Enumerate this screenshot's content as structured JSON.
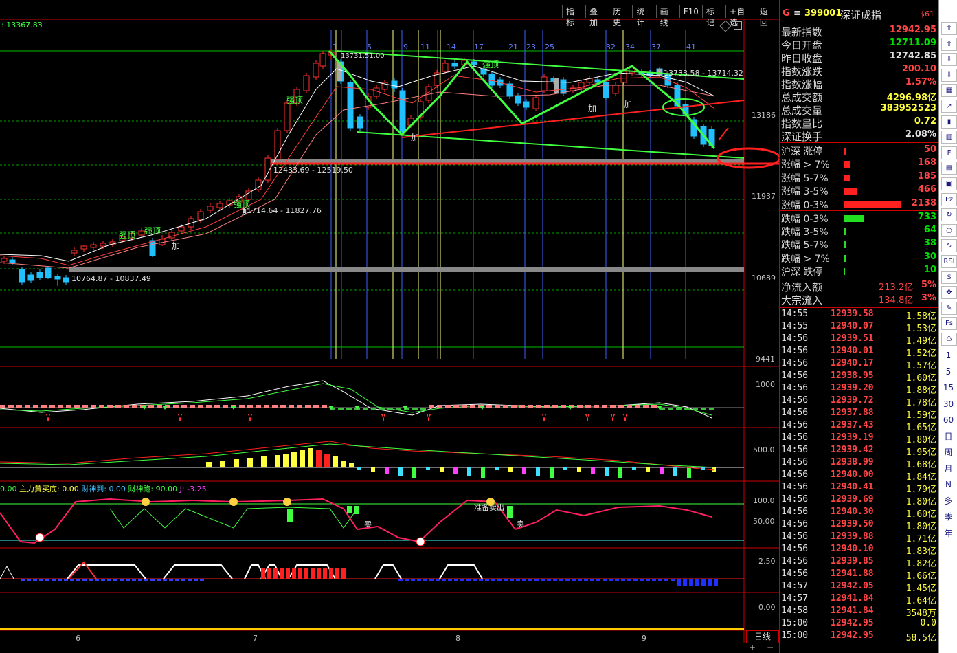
{
  "toolbar": [
    "指标",
    "叠加",
    "历史",
    "统计",
    "画线",
    "F10",
    "标记",
    "+自选",
    "返回"
  ],
  "chart": {
    "top_left_value": ": 13367.83",
    "y_axis_labels": [
      "13186",
      "11937",
      "10689",
      "9441"
    ],
    "date_labels": [
      "6",
      "7",
      "8",
      "9"
    ],
    "period_label": "日线",
    "wave_numbers": [
      "1",
      "5",
      "9",
      "11",
      "14",
      "17",
      "21",
      "23",
      "25",
      "32",
      "34",
      "37",
      "41"
    ],
    "annotations": {
      "range1": "12433.69 - 12519.50",
      "range2": "11714.64 - 11827.76",
      "range3": "10764.87 - 10837.49",
      "range4": "13733.58 - 13714.32",
      "top_range": "13731.51.00",
      "strong_top": "强顶",
      "add": "加",
      "sell": "卖",
      "ready_sell": "准备卖出"
    },
    "sub1_axis": "1000",
    "sub2_axis": "500.0",
    "sub3_header": {
      "zero": "0.00",
      "zhuli_label": "主力黄买底:",
      "zhuli_value": "0.00",
      "caishen_dao_label": "财神到:",
      "caishen_dao_value": "0.00",
      "caishen_pao_label": "财神跑:",
      "caishen_pao_value": "90.00",
      "j_label": "J:",
      "j_value": "-3.25"
    },
    "sub3_axis": [
      "100.0",
      "50.00"
    ],
    "sub4_axis": "2.50",
    "sub5_axis": "0.00"
  },
  "panel": {
    "title_code": "399001",
    "title_name": "深证成指",
    "title_flag": "$61",
    "stats": [
      {
        "label": "最新指数",
        "value": "12942.95",
        "color": "red"
      },
      {
        "label": "今日开盘",
        "value": "12711.09",
        "color": "green"
      },
      {
        "label": "昨日收盘",
        "value": "12742.85",
        "color": "white"
      },
      {
        "label": "指数涨跌",
        "value": "200.10",
        "color": "red"
      },
      {
        "label": "指数涨幅",
        "value": "1.57%",
        "color": "red"
      },
      {
        "label": "总成交额",
        "value": "4296.98亿",
        "color": "yellow"
      },
      {
        "label": "总成交量",
        "value": "383952523",
        "color": "yellow"
      },
      {
        "label": "指数量比",
        "value": "0.72",
        "color": "yellow"
      },
      {
        "label": "深证换手",
        "value": "2.08%",
        "color": "white"
      }
    ],
    "ups": [
      {
        "label": "沪深 涨停",
        "value": "50",
        "bar": 2
      },
      {
        "label": "涨幅 > 7%",
        "value": "168",
        "bar": 8
      },
      {
        "label": "涨幅 5-7%",
        "value": "185",
        "bar": 8
      },
      {
        "label": "涨幅 3-5%",
        "value": "466",
        "bar": 18
      },
      {
        "label": "涨幅 0-3%",
        "value": "2138",
        "bar": 82
      }
    ],
    "downs": [
      {
        "label": "跌幅 0-3%",
        "value": "733",
        "bar": 28
      },
      {
        "label": "跌幅 3-5%",
        "value": "64",
        "bar": 2
      },
      {
        "label": "跌幅 5-7%",
        "value": "38",
        "bar": 2
      },
      {
        "label": "跌幅 > 7%",
        "value": "30",
        "bar": 2
      },
      {
        "label": "沪深 跌停",
        "value": "10",
        "bar": 1
      }
    ],
    "flows": [
      {
        "label": "净流入额",
        "value": "213.2亿",
        "pct": "5%"
      },
      {
        "label": "大宗流入",
        "value": "134.8亿",
        "pct": "3%"
      }
    ],
    "ticks": [
      [
        "14:55",
        "12939.58",
        "1.58亿"
      ],
      [
        "14:55",
        "12940.07",
        "1.53亿"
      ],
      [
        "14:56",
        "12939.51",
        "1.49亿"
      ],
      [
        "14:56",
        "12940.01",
        "1.52亿"
      ],
      [
        "14:56",
        "12940.17",
        "1.57亿"
      ],
      [
        "14:56",
        "12938.95",
        "1.60亿"
      ],
      [
        "14:56",
        "12939.20",
        "1.88亿"
      ],
      [
        "14:56",
        "12939.72",
        "1.78亿"
      ],
      [
        "14:56",
        "12937.88",
        "1.59亿"
      ],
      [
        "14:56",
        "12937.43",
        "1.65亿"
      ],
      [
        "14:56",
        "12939.19",
        "1.80亿"
      ],
      [
        "14:56",
        "12939.42",
        "1.95亿"
      ],
      [
        "14:56",
        "12938.99",
        "1.68亿"
      ],
      [
        "14:56",
        "12940.00",
        "1.84亿"
      ],
      [
        "14:56",
        "12940.41",
        "1.79亿"
      ],
      [
        "14:56",
        "12939.69",
        "1.80亿"
      ],
      [
        "14:56",
        "12940.30",
        "1.60亿"
      ],
      [
        "14:56",
        "12939.50",
        "1.80亿"
      ],
      [
        "14:56",
        "12939.88",
        "1.71亿"
      ],
      [
        "14:56",
        "12940.10",
        "1.83亿"
      ],
      [
        "14:56",
        "12939.85",
        "1.82亿"
      ],
      [
        "14:56",
        "12941.88",
        "1.66亿"
      ],
      [
        "14:57",
        "12942.05",
        "1.45亿"
      ],
      [
        "14:57",
        "12941.84",
        "1.64亿"
      ],
      [
        "14:58",
        "12941.84",
        "3548万"
      ],
      [
        "15:00",
        "12942.95",
        "0.0"
      ],
      [
        "15:00",
        "12942.95",
        "58.5亿"
      ]
    ]
  },
  "sidebar": {
    "icons": [
      "scroll-up-icon",
      "page-up-icon",
      "page-down-icon",
      "scroll-down-icon",
      "grid-icon",
      "line-chart-icon",
      "candle-chart-icon",
      "bar-chart-icon",
      "f10-icon",
      "quote-icon",
      "book-icon",
      "fz-icon",
      "refresh-icon",
      "ring-icon",
      "wave-icon",
      "rsi-icon",
      "dollar-icon",
      "move-icon",
      "pencil-icon",
      "fs-icon",
      "recycle-icon"
    ],
    "labels": [
      "1",
      "5",
      "15",
      "30",
      "60",
      "日",
      "周",
      "月",
      "N",
      "多",
      "季",
      "年"
    ]
  },
  "colors": {
    "up": "#ff3030",
    "down": "#00e0ff",
    "grid": "#7a0000",
    "accent_green": "#40ff40",
    "border": "#cc0000"
  }
}
